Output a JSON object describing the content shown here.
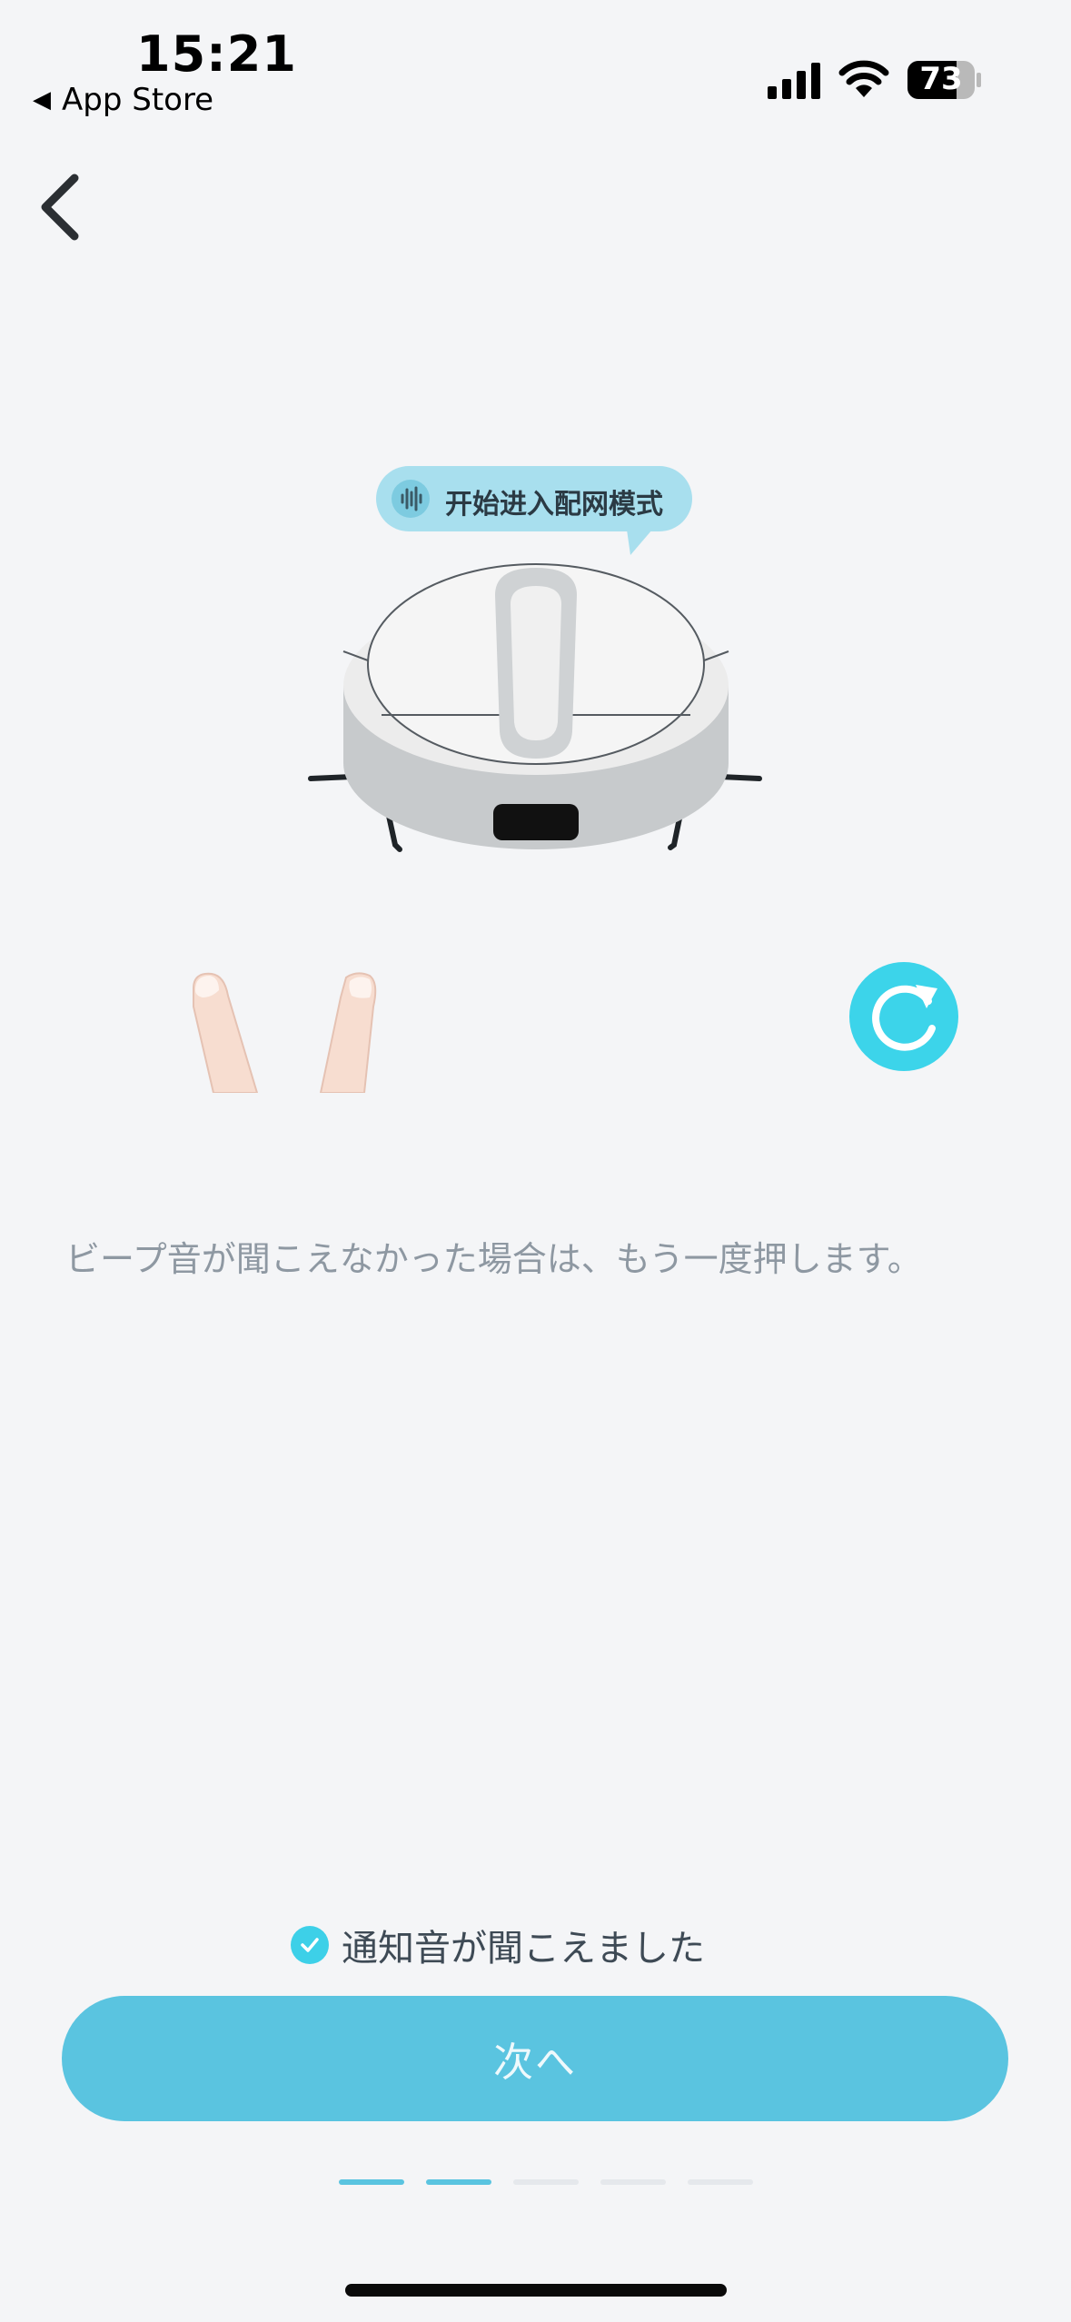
{
  "status_bar": {
    "time": "15:21",
    "back_app_label": "App Store",
    "battery": "73"
  },
  "illustration": {
    "bubble_text": "开始进入配网模式"
  },
  "instruction": "ビープ音が聞こえなかった場合は、もう一度押します。",
  "confirm": {
    "label": "通知音が聞こえました",
    "checked": true
  },
  "next_button": {
    "label": "次へ"
  },
  "pager": {
    "total": 5,
    "active": [
      1,
      2
    ]
  },
  "colors": {
    "accent": "#5ac4e0",
    "check": "#3dd0e8",
    "replay": "#3cd4ea",
    "background": "#f4f5f7"
  },
  "icons": {
    "back": "chevron-left-icon",
    "replay": "replay-icon",
    "speaker": "sound-wave-icon"
  }
}
